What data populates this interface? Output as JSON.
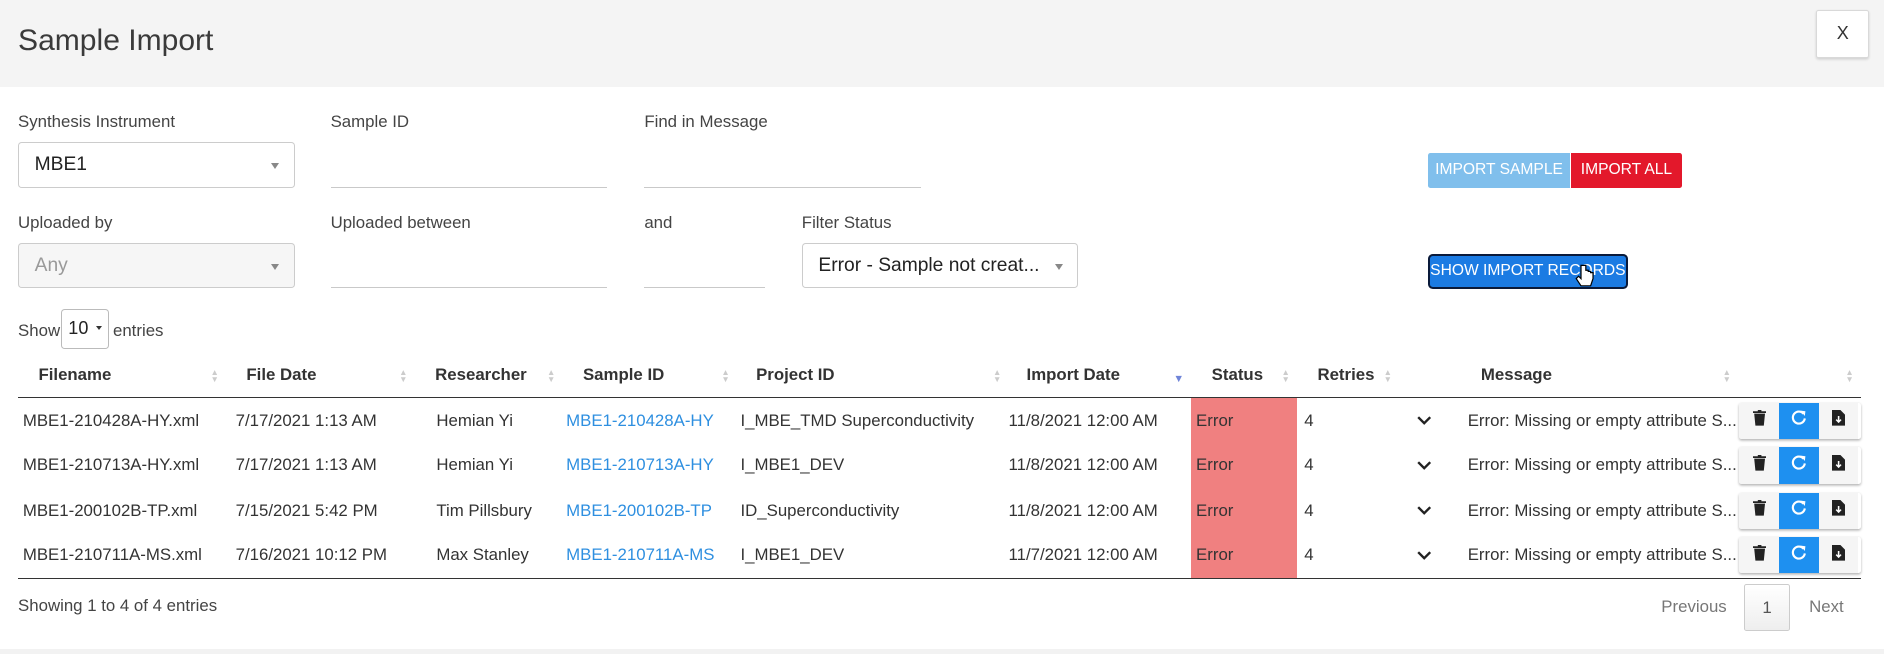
{
  "window": {
    "title": "Sample Import",
    "close_label": "X"
  },
  "filters": {
    "instrument": {
      "label": "Synthesis Instrument",
      "value": "MBE1"
    },
    "sample_id": {
      "label": "Sample ID",
      "value": ""
    },
    "find_message": {
      "label": "Find in Message",
      "value": ""
    },
    "uploaded_by": {
      "label": "Uploaded by",
      "value": "Any"
    },
    "uploaded_between": {
      "label": "Uploaded between",
      "value": ""
    },
    "and": {
      "label": "and",
      "value": ""
    },
    "status": {
      "label": "Filter Status",
      "value": "Error - Sample not creat..."
    }
  },
  "buttons": {
    "import_sample": "IMPORT SAMPLE",
    "import_all": "IMPORT ALL",
    "show_records": "SHOW IMPORT RECORDS"
  },
  "length": {
    "show": "Show",
    "value": "10",
    "entries": "entries"
  },
  "table": {
    "columns": [
      "Filename",
      "File Date",
      "Researcher",
      "Sample ID",
      "Project ID",
      "Import Date",
      "Status",
      "Retries",
      "",
      "Message",
      ""
    ],
    "rows": [
      {
        "filename": "MBE1-210428A-HY.xml",
        "file_date": "7/17/2021 1:13 AM",
        "researcher": "Hemian Yi",
        "sample_id": "MBE1-210428A-HY",
        "project_id": "I_MBE_TMD Superconductivity",
        "import_date": "11/8/2021 12:00 AM",
        "status": "Error",
        "retries": "4",
        "message": "Error: Missing or empty attribute S..."
      },
      {
        "filename": "MBE1-210713A-HY.xml",
        "file_date": "7/17/2021 1:13 AM",
        "researcher": "Hemian Yi",
        "sample_id": "MBE1-210713A-HY",
        "project_id": "I_MBE1_DEV",
        "import_date": "11/8/2021 12:00 AM",
        "status": "Error",
        "retries": "4",
        "message": "Error: Missing or empty attribute S..."
      },
      {
        "filename": "MBE1-200102B-TP.xml",
        "file_date": "7/15/2021 5:42 PM",
        "researcher": "Tim Pillsbury",
        "sample_id": "MBE1-200102B-TP",
        "project_id": "ID_Superconductivity",
        "import_date": "11/8/2021 12:00 AM",
        "status": "Error",
        "retries": "4",
        "message": "Error: Missing or empty attribute S..."
      },
      {
        "filename": "MBE1-210711A-MS.xml",
        "file_date": "7/16/2021 10:12 PM",
        "researcher": "Max Stanley",
        "sample_id": "MBE1-210711A-MS",
        "project_id": "I_MBE1_DEV",
        "import_date": "11/7/2021 12:00 AM",
        "status": "Error",
        "retries": "4",
        "message": "Error: Missing or empty attribute S..."
      }
    ]
  },
  "footer": {
    "info": "Showing 1 to 4 of 4 entries",
    "previous": "Previous",
    "page": "1",
    "next": "Next"
  },
  "colors": {
    "error": "#f08080",
    "link": "#2e8fe0",
    "primary": "#1e90f0",
    "danger": "#e3182b"
  },
  "icons": [
    "close-icon",
    "trash-icon",
    "refresh-icon",
    "file-download-icon",
    "chevron-down-icon",
    "sort-icon",
    "cursor-icon"
  ]
}
